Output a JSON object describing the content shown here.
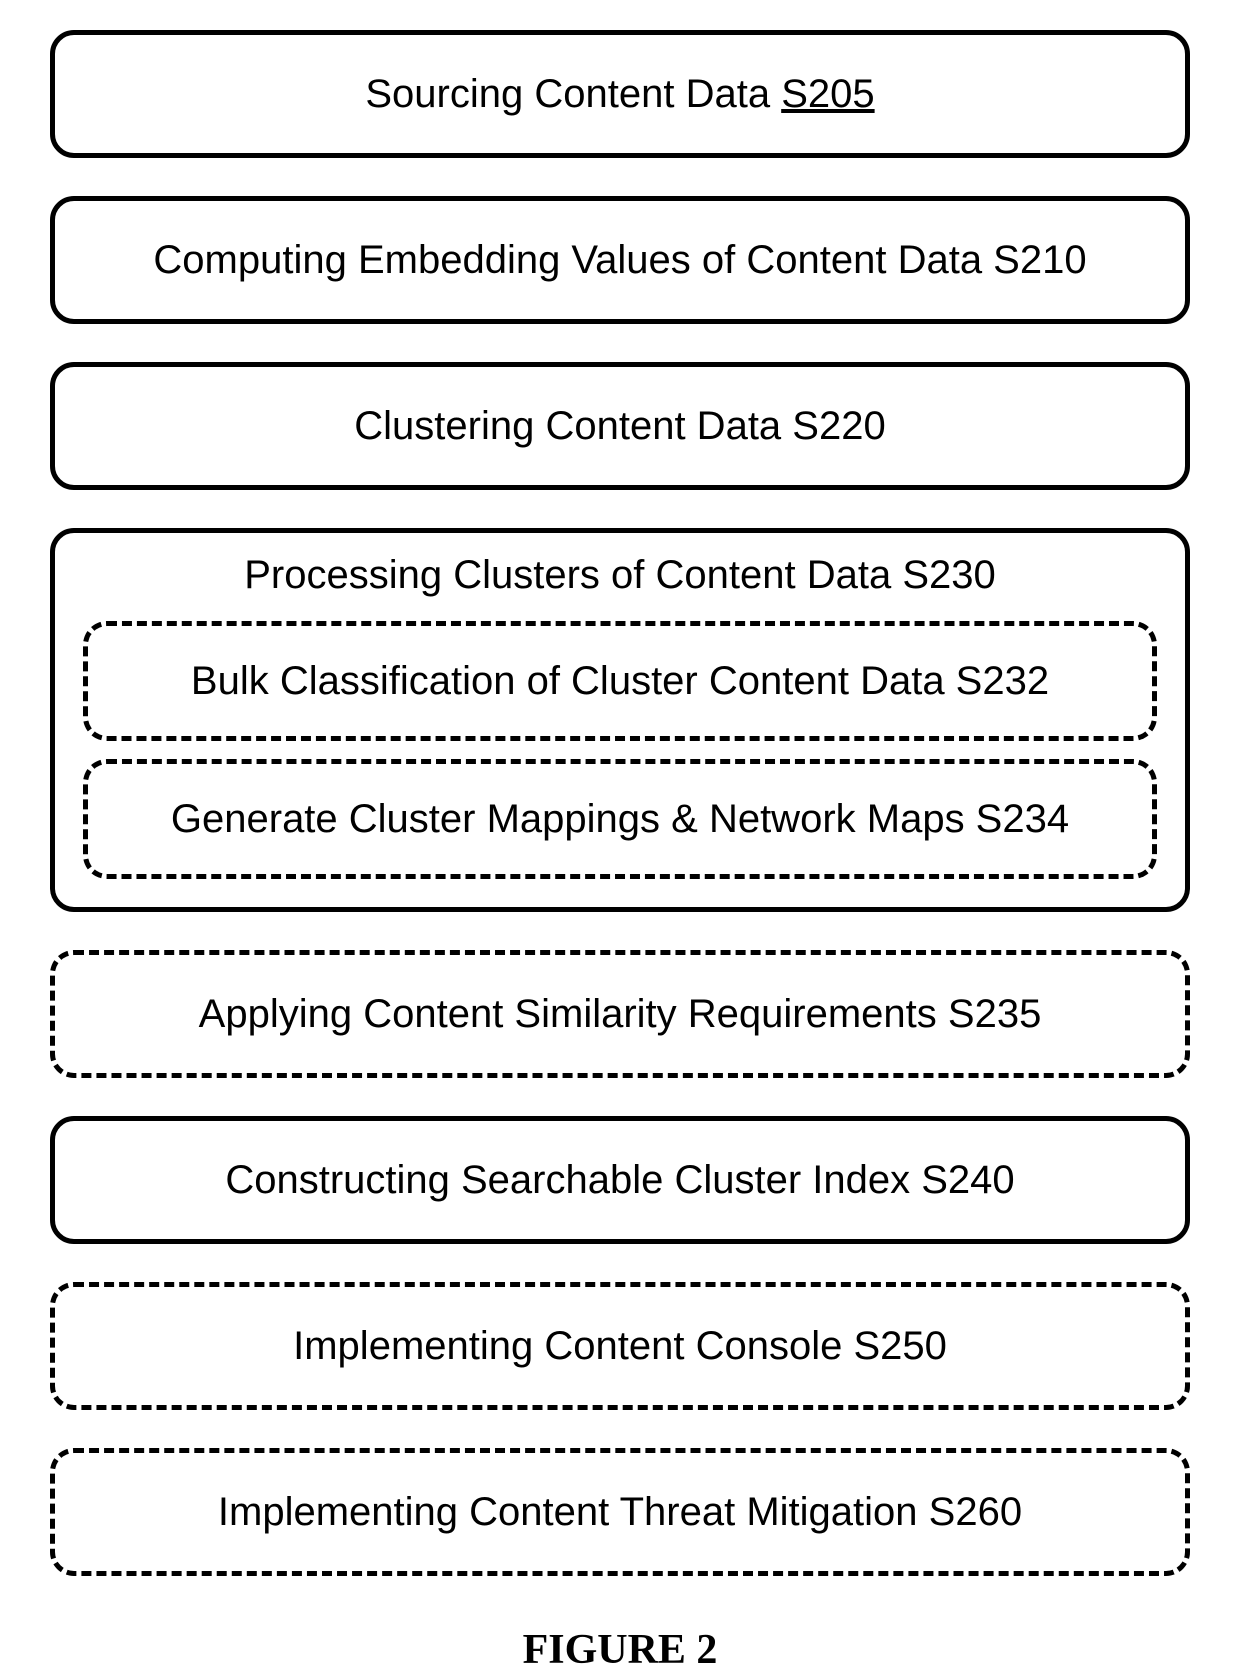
{
  "steps": {
    "s205_prefix": "Sourcing Content Data ",
    "s205_code": "S205",
    "s210": "Computing Embedding Values of Content Data S210",
    "s220": "Clustering Content Data S220",
    "s230_title": "Processing Clusters of Content Data S230",
    "s232": "Bulk Classification of Cluster Content Data S232",
    "s234": "Generate Cluster Mappings & Network Maps S234",
    "s235": "Applying Content Similarity Requirements S235",
    "s240": "Constructing Searchable Cluster Index S240",
    "s250": "Implementing Content Console S250",
    "s260": "Implementing Content Threat Mitigation S260"
  },
  "caption": "FIGURE 2"
}
